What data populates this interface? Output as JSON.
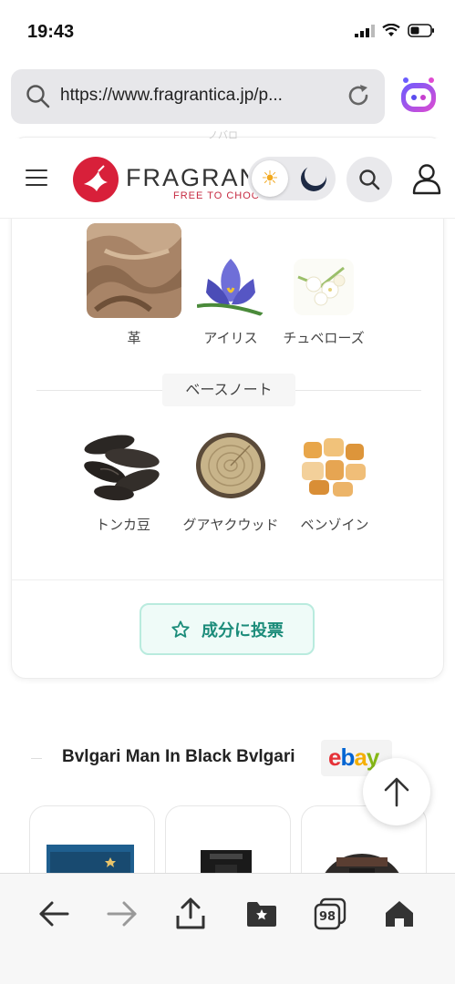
{
  "status_bar": {
    "time": "19:43"
  },
  "browser": {
    "url": "https://www.fragrantica.jp/p..."
  },
  "site": {
    "logo_text": "FRAGRANTICA",
    "tagline": "FREE TO CHOOSE",
    "faded_text": "ノバロ"
  },
  "notes": {
    "middle": [
      {
        "label": "革"
      },
      {
        "label": "アイリス"
      },
      {
        "label": "チュベローズ"
      }
    ],
    "base_label": "ベースノート",
    "base": [
      {
        "label": "トンカ豆"
      },
      {
        "label": "グアヤクウッド"
      },
      {
        "label": "ベンゾイン"
      }
    ]
  },
  "vote_button": {
    "label": "成分に投票"
  },
  "shop": {
    "title": "Bvlgari Man In Black Bvlgari",
    "ebay": "ebay"
  },
  "toolbar": {
    "tab_count": "98"
  },
  "colors": {
    "brand_red": "#d8203a",
    "vote_text": "#1b8c7a",
    "vote_border": "#b9ebde"
  }
}
